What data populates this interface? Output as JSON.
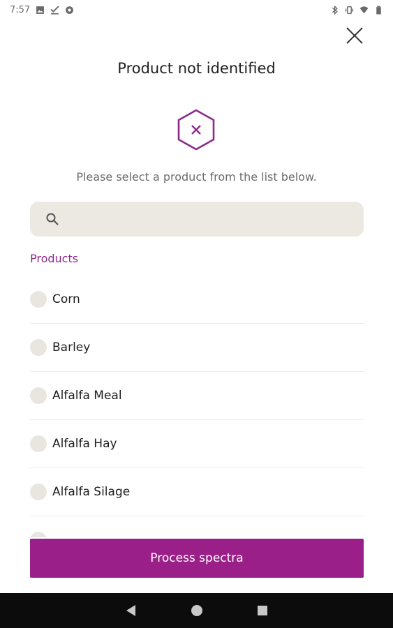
{
  "status_bar": {
    "time": "7:57",
    "left_icons": [
      "image-icon",
      "check-download-icon",
      "circle-app-icon"
    ],
    "right_icons": [
      "bluetooth-icon",
      "vibrate-icon",
      "wifi-icon",
      "battery-icon"
    ]
  },
  "dialog": {
    "title": "Product not identified",
    "subtitle": "Please select a product from the list below.",
    "close_icon": "close-icon",
    "status_icon": "hexagon-x-icon"
  },
  "search": {
    "placeholder": "",
    "value": ""
  },
  "products": {
    "label": "Products",
    "items": [
      {
        "label": "Corn",
        "selected": false
      },
      {
        "label": "Barley",
        "selected": false
      },
      {
        "label": "Alfalfa Meal",
        "selected": false
      },
      {
        "label": "Alfalfa Hay",
        "selected": false
      },
      {
        "label": "Alfalfa Silage",
        "selected": false
      },
      {
        "label": "",
        "selected": false
      }
    ]
  },
  "actions": {
    "process_label": "Process spectra"
  },
  "colors": {
    "accent": "#9b1f88",
    "section_label": "#8e2a8a",
    "search_bg": "#ebe9e2",
    "radio_bg": "#e8e6df"
  }
}
